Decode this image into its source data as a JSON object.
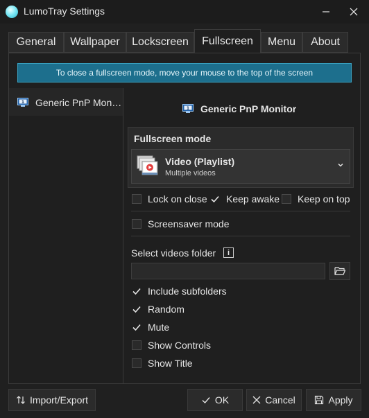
{
  "window": {
    "title": "LumoTray Settings"
  },
  "tabs": [
    {
      "label": "General"
    },
    {
      "label": "Wallpaper"
    },
    {
      "label": "Lockscreen"
    },
    {
      "label": "Fullscreen",
      "active": true
    },
    {
      "label": "Menu"
    },
    {
      "label": "About"
    }
  ],
  "banner": {
    "text": "To close a fullscreen mode, move your mouse to the top of the screen"
  },
  "monitors": {
    "list": [
      {
        "label": "Generic PnP Mon…"
      }
    ],
    "selected": "Generic PnP Monitor"
  },
  "fullscreen_mode": {
    "heading": "Fullscreen mode",
    "selected_title": "Video (Playlist)",
    "selected_subtitle": "Multiple videos"
  },
  "options": {
    "lock_on_close": {
      "label": "Lock on close",
      "checked": false
    },
    "keep_awake": {
      "label": "Keep awake",
      "checked": true
    },
    "keep_on_top": {
      "label": "Keep on top",
      "checked": false
    },
    "screensaver_mode": {
      "label": "Screensaver mode",
      "checked": false
    }
  },
  "video_folder": {
    "label": "Select videos folder",
    "info_icon": "i",
    "value": ""
  },
  "video_options": [
    {
      "label": "Include subfolders",
      "checked": true
    },
    {
      "label": "Random",
      "checked": true
    },
    {
      "label": "Mute",
      "checked": true
    },
    {
      "label": "Show Controls",
      "checked": false
    },
    {
      "label": "Show Title",
      "checked": false
    }
  ],
  "footer": {
    "import_export": "Import/Export",
    "ok": "OK",
    "cancel": "Cancel",
    "apply": "Apply"
  },
  "colors": {
    "accent_banner": "#1d6f8d",
    "background": "#202020"
  }
}
